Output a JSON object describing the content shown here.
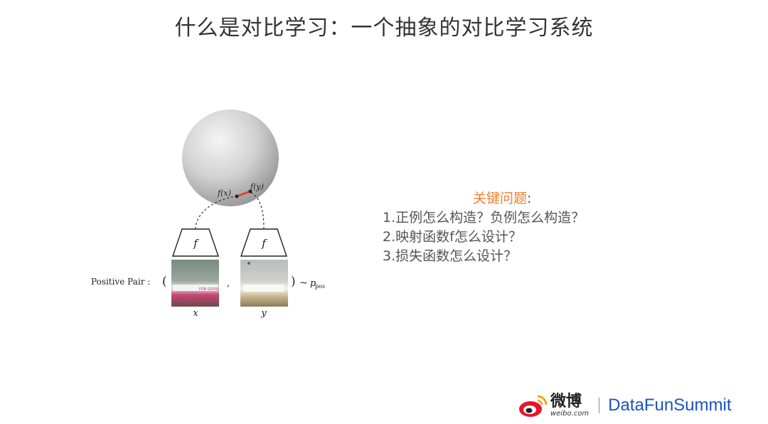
{
  "title": "什么是对比学习：一个抽象的对比学习系统",
  "diagram": {
    "fx_label": "f(x)",
    "fy_label": "f(y)",
    "encoder_left": "f",
    "encoder_right": "f",
    "positive_pair_label": "Positive Pair :",
    "open_paren": "(",
    "comma": ",",
    "close_paren": ")",
    "tilde": "~",
    "p_label": "p",
    "pos_sub": "pos",
    "x_label": "x",
    "y_label": "y",
    "img_left_text": "FOR GOOD"
  },
  "key_questions": {
    "title": "关键问题",
    "colon": ":",
    "items": [
      "1.正例怎么构造？负例怎么构造？",
      "2.映射函数f怎么设计？",
      "3.损失函数怎么设计？"
    ]
  },
  "footer": {
    "weibo": "微博",
    "weibo_sub": "weibo.com",
    "brand": "DataFunSummit"
  },
  "colors": {
    "accent": "#f07f2a",
    "brand": "#1a52c6",
    "connector": "#e0452b"
  }
}
